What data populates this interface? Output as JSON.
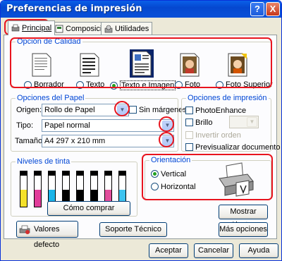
{
  "window": {
    "title": "Preferencias de impresión",
    "help_btn": "?",
    "close_btn": "X"
  },
  "tabs": [
    "Principal",
    "Composición",
    "Utilidades"
  ],
  "quality": {
    "title": "Opción de Calidad",
    "options": [
      "Borrador",
      "Texto",
      "Texto e Imagen",
      "Foto",
      "Foto Superior"
    ],
    "selected": "Texto e Imagen"
  },
  "paper": {
    "title": "Opciones del Papel",
    "source_label": "Origen:",
    "source_value": "Rollo de Papel",
    "borderless_label": "Sin márgenes",
    "type_label": "Tipo:",
    "type_value": "Papel normal",
    "size_label": "Tamaño:",
    "size_value": "A4 297 x 210 mm"
  },
  "print_options": {
    "title": "Opciones de impresión",
    "photoenhance": "PhotoEnhance",
    "brillo": "Brillo",
    "invertir": "Invertir orden",
    "previsualizar": "Previsualizar documento"
  },
  "ink": {
    "title": "Niveles de tinta",
    "colors": [
      "#F5E12A",
      "#E13C9A",
      "#1AB4E8",
      "#000000",
      "#000000",
      "#000000",
      "#E24E9C",
      "#3EC3EF"
    ],
    "levels": [
      0.55,
      0.55,
      0.55,
      0.55,
      0.55,
      0.55,
      0.55,
      0.55
    ],
    "buy_button": "Cómo comprar"
  },
  "orientation": {
    "title": "Orientación",
    "vertical": "Vertical",
    "horizontal": "Horizontal",
    "selected": "Vertical"
  },
  "buttons": {
    "defaults": "Valores defecto",
    "support": "Soporte Técnico",
    "show_settings": "Mostrar Ajustes",
    "more_options": "Más opciones",
    "ok": "Aceptar",
    "cancel": "Cancelar",
    "help": "Ayuda"
  }
}
